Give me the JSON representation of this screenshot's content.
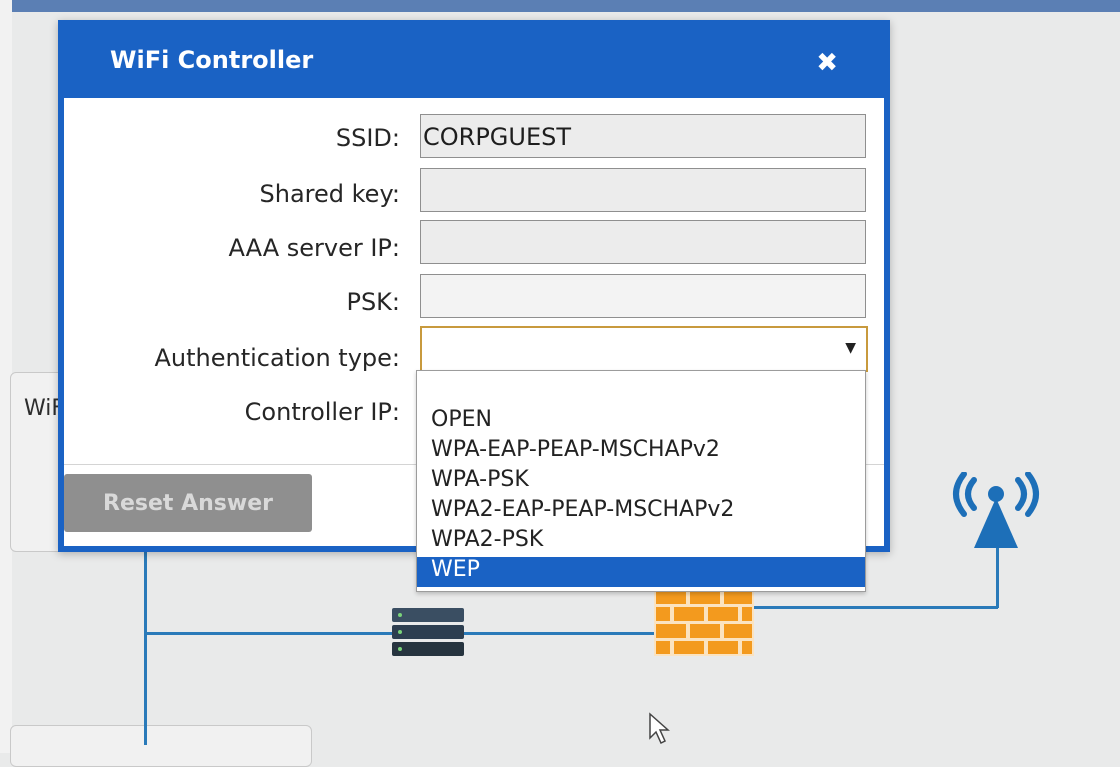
{
  "dialog": {
    "title": "WiFi Controller",
    "close_icon": "close-icon"
  },
  "form": {
    "ssid_label": "SSID:",
    "ssid_value": "CORPGUEST",
    "shared_key_label": "Shared key:",
    "shared_key_value": "",
    "aaa_server_label": "AAA server IP:",
    "aaa_server_value": "",
    "psk_label": "PSK:",
    "psk_value": "",
    "auth_type_label": "Authentication type:",
    "auth_type_value": "",
    "controller_ip_label": "Controller IP:"
  },
  "dropdown": {
    "options": [
      "OPEN",
      "WPA-EAP-PEAP-MSCHAPv2",
      "WPA-PSK",
      "WPA2-EAP-PEAP-MSCHAPv2",
      "WPA2-PSK",
      "WEP"
    ],
    "highlighted": "WEP"
  },
  "footer": {
    "reset_label": "Reset Answer"
  },
  "background": {
    "wifi_label": "WiF"
  },
  "colors": {
    "accent": "#1a62c4",
    "line": "#2a7ab9",
    "firewall": "#f39a1e"
  },
  "icons": [
    "server-icon",
    "firewall-icon",
    "access-point-icon",
    "mouse-cursor-icon"
  ]
}
